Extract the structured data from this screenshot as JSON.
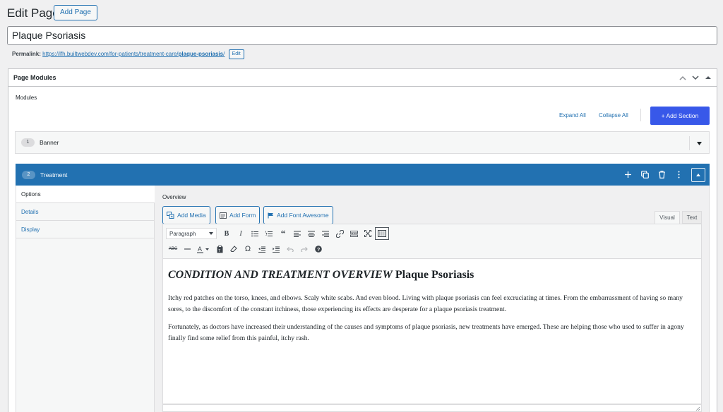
{
  "header": {
    "title": "Edit Page",
    "add_page_label": "Add Page"
  },
  "post": {
    "title_value": "Plaque Psoriasis",
    "permalink_label": "Permalink:",
    "permalink_base": "https://lfh.builtwebdev.com/for-patients/treatment-care/",
    "permalink_slug": "plaque-psoriasis",
    "permalink_trailing": "/",
    "edit_label": "Edit"
  },
  "postbox": {
    "title": "Page Modules",
    "modules_label": "Modules",
    "expand_all": "Expand All",
    "collapse_all": "Collapse All",
    "add_section": "+ Add Section"
  },
  "sections": [
    {
      "number": "1",
      "label": "Banner",
      "expanded": false
    },
    {
      "number": "2",
      "label": "Treatment",
      "expanded": true
    }
  ],
  "treatment": {
    "tabs": [
      {
        "label": "Options",
        "active": true
      },
      {
        "label": "Details",
        "active": false
      },
      {
        "label": "Display",
        "active": false
      }
    ],
    "field_label": "Overview",
    "media_buttons": {
      "add_media": "Add Media",
      "add_form": "Add Form",
      "add_font_awesome": "Add Font Awesome"
    },
    "editor_tabs": {
      "visual": "Visual",
      "text": "Text"
    },
    "format_select": "Paragraph",
    "content": {
      "heading_italic": "CONDITION AND TREATMENT OVERVIEW",
      "heading_rest": " Plaque Psoriasis",
      "paragraph_1": "Itchy red patches on the torso, knees, and elbows. Scaly white scabs. And even blood. Living with plaque psoriasis can feel excruciating at times. From the embarrassment of having so many sores, to the discomfort of the constant itchiness, those experiencing its effects are desperate for a plaque psoriasis treatment.",
      "paragraph_2": "Fortunately, as doctors have increased their understanding of the causes and symptoms of plaque psoriasis, new treatments have emerged. These are helping those who used to suffer in agony finally find some relief from this painful, itchy rash."
    }
  },
  "colors": {
    "accent": "#2271b1",
    "primary_button": "#3858e9",
    "section_bar": "#2271b1"
  }
}
